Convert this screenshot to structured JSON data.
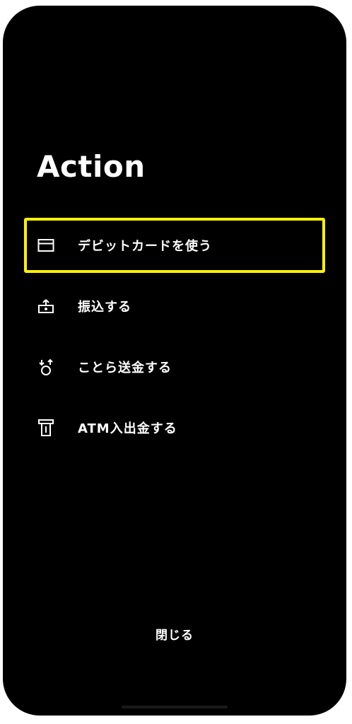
{
  "colors": {
    "background": "#000000",
    "text": "#ffffff",
    "highlight": "#FFF200"
  },
  "header": {
    "title": "Action"
  },
  "menu": {
    "items": [
      {
        "icon": "card-icon",
        "label": "デビットカードを使う",
        "highlighted": true
      },
      {
        "icon": "transfer-icon",
        "label": "振込する",
        "highlighted": false
      },
      {
        "icon": "remit-icon",
        "label": "ことら送金する",
        "highlighted": false
      },
      {
        "icon": "atm-icon",
        "label": "ATM入出金する",
        "highlighted": false
      }
    ]
  },
  "footer": {
    "close_label": "閉じる"
  }
}
